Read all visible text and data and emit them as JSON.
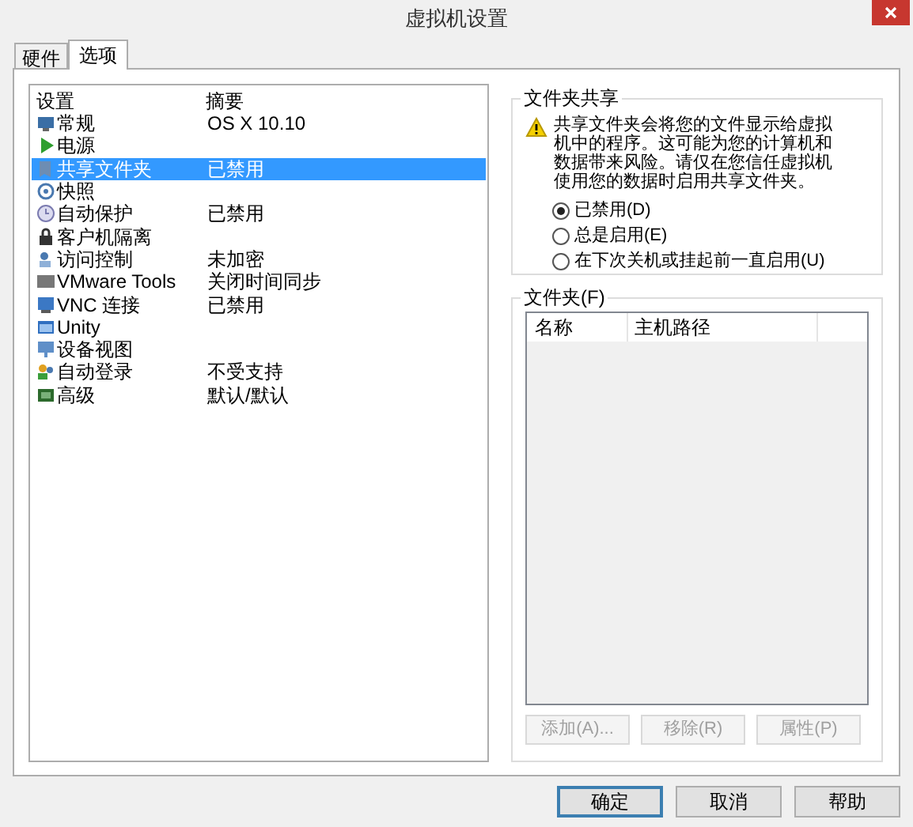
{
  "window": {
    "title": "虚拟机设置"
  },
  "tabs": [
    {
      "label": "硬件",
      "selected": false
    },
    {
      "label": "选项",
      "selected": true
    }
  ],
  "settings": {
    "columns": [
      "设置",
      "摘要"
    ],
    "rows": [
      {
        "name": "常规",
        "summary": "OS X 10.10",
        "selected": false
      },
      {
        "name": "电源",
        "summary": "",
        "selected": false
      },
      {
        "name": "共享文件夹",
        "summary": "已禁用",
        "selected": true
      },
      {
        "name": "快照",
        "summary": "",
        "selected": false
      },
      {
        "name": "自动保护",
        "summary": "已禁用",
        "selected": false
      },
      {
        "name": "客户机隔离",
        "summary": "",
        "selected": false
      },
      {
        "name": "访问控制",
        "summary": "未加密",
        "selected": false
      },
      {
        "name": "VMware Tools",
        "summary": "关闭时间同步",
        "selected": false
      },
      {
        "name": "VNC 连接",
        "summary": "已禁用",
        "selected": false
      },
      {
        "name": "Unity",
        "summary": "",
        "selected": false
      },
      {
        "name": "设备视图",
        "summary": "",
        "selected": false
      },
      {
        "name": "自动登录",
        "summary": "不受支持",
        "selected": false
      },
      {
        "name": "高级",
        "summary": "默认/默认",
        "selected": false
      }
    ]
  },
  "sharing": {
    "title": "文件夹共享",
    "warning": "共享文件夹会将您的文件显示给虚拟机中的程序。这可能为您的计算机和数据带来风险。请仅在您信任虚拟机使用您的数据时启用共享文件夹。",
    "options": [
      {
        "label": "已禁用(D)",
        "selected": true
      },
      {
        "label": "总是启用(E)",
        "selected": false
      },
      {
        "label": "在下次关机或挂起前一直启用(U)",
        "selected": false
      }
    ]
  },
  "folders": {
    "title": "文件夹(F)",
    "columns": [
      "名称",
      "主机路径"
    ],
    "buttons": [
      {
        "label": "添加(A)...",
        "disabled": true
      },
      {
        "label": "移除(R)",
        "disabled": true
      },
      {
        "label": "属性(P)",
        "disabled": true
      }
    ]
  },
  "buttons": [
    {
      "label": "确定",
      "default": true
    },
    {
      "label": "取消",
      "default": false
    },
    {
      "label": "帮助",
      "default": false
    }
  ]
}
